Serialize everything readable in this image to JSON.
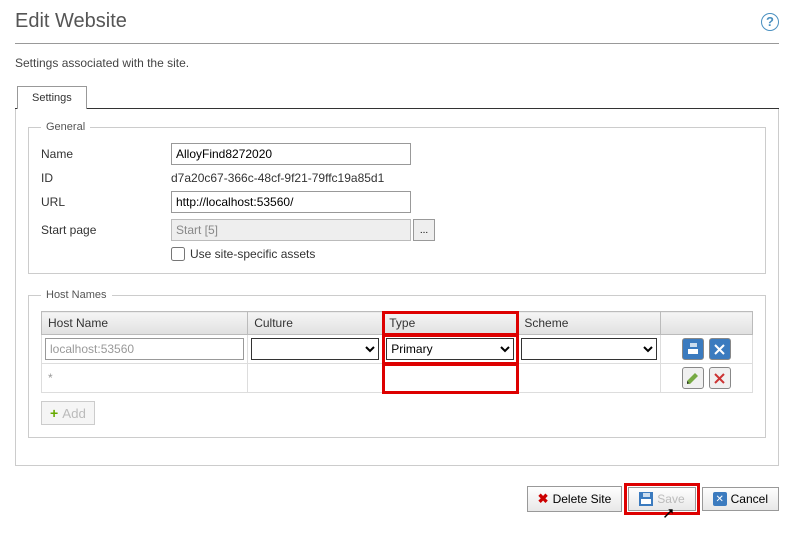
{
  "header": {
    "title": "Edit Website"
  },
  "subtitle": "Settings associated with the site.",
  "tabs": {
    "settings": "Settings"
  },
  "general": {
    "legend": "General",
    "name_label": "Name",
    "name_value": "AlloyFind8272020",
    "id_label": "ID",
    "id_value": "d7a20c67-366c-48cf-9f21-79ffc19a85d1",
    "url_label": "URL",
    "url_value": "http://localhost:53560/",
    "startpage_label": "Start page",
    "startpage_value": "Start [5]",
    "browse_label": "...",
    "sitespecific_label": "Use site-specific assets"
  },
  "hostnames": {
    "legend": "Host Names",
    "col_hostname": "Host Name",
    "col_culture": "Culture",
    "col_type": "Type",
    "col_scheme": "Scheme",
    "row1": {
      "hostname": "localhost:53560",
      "culture": "",
      "type": "Primary",
      "scheme": ""
    },
    "row2": {
      "hostname": "*"
    },
    "add_label": "Add"
  },
  "footer": {
    "delete_label": "Delete Site",
    "save_label": "Save",
    "cancel_label": "Cancel"
  }
}
